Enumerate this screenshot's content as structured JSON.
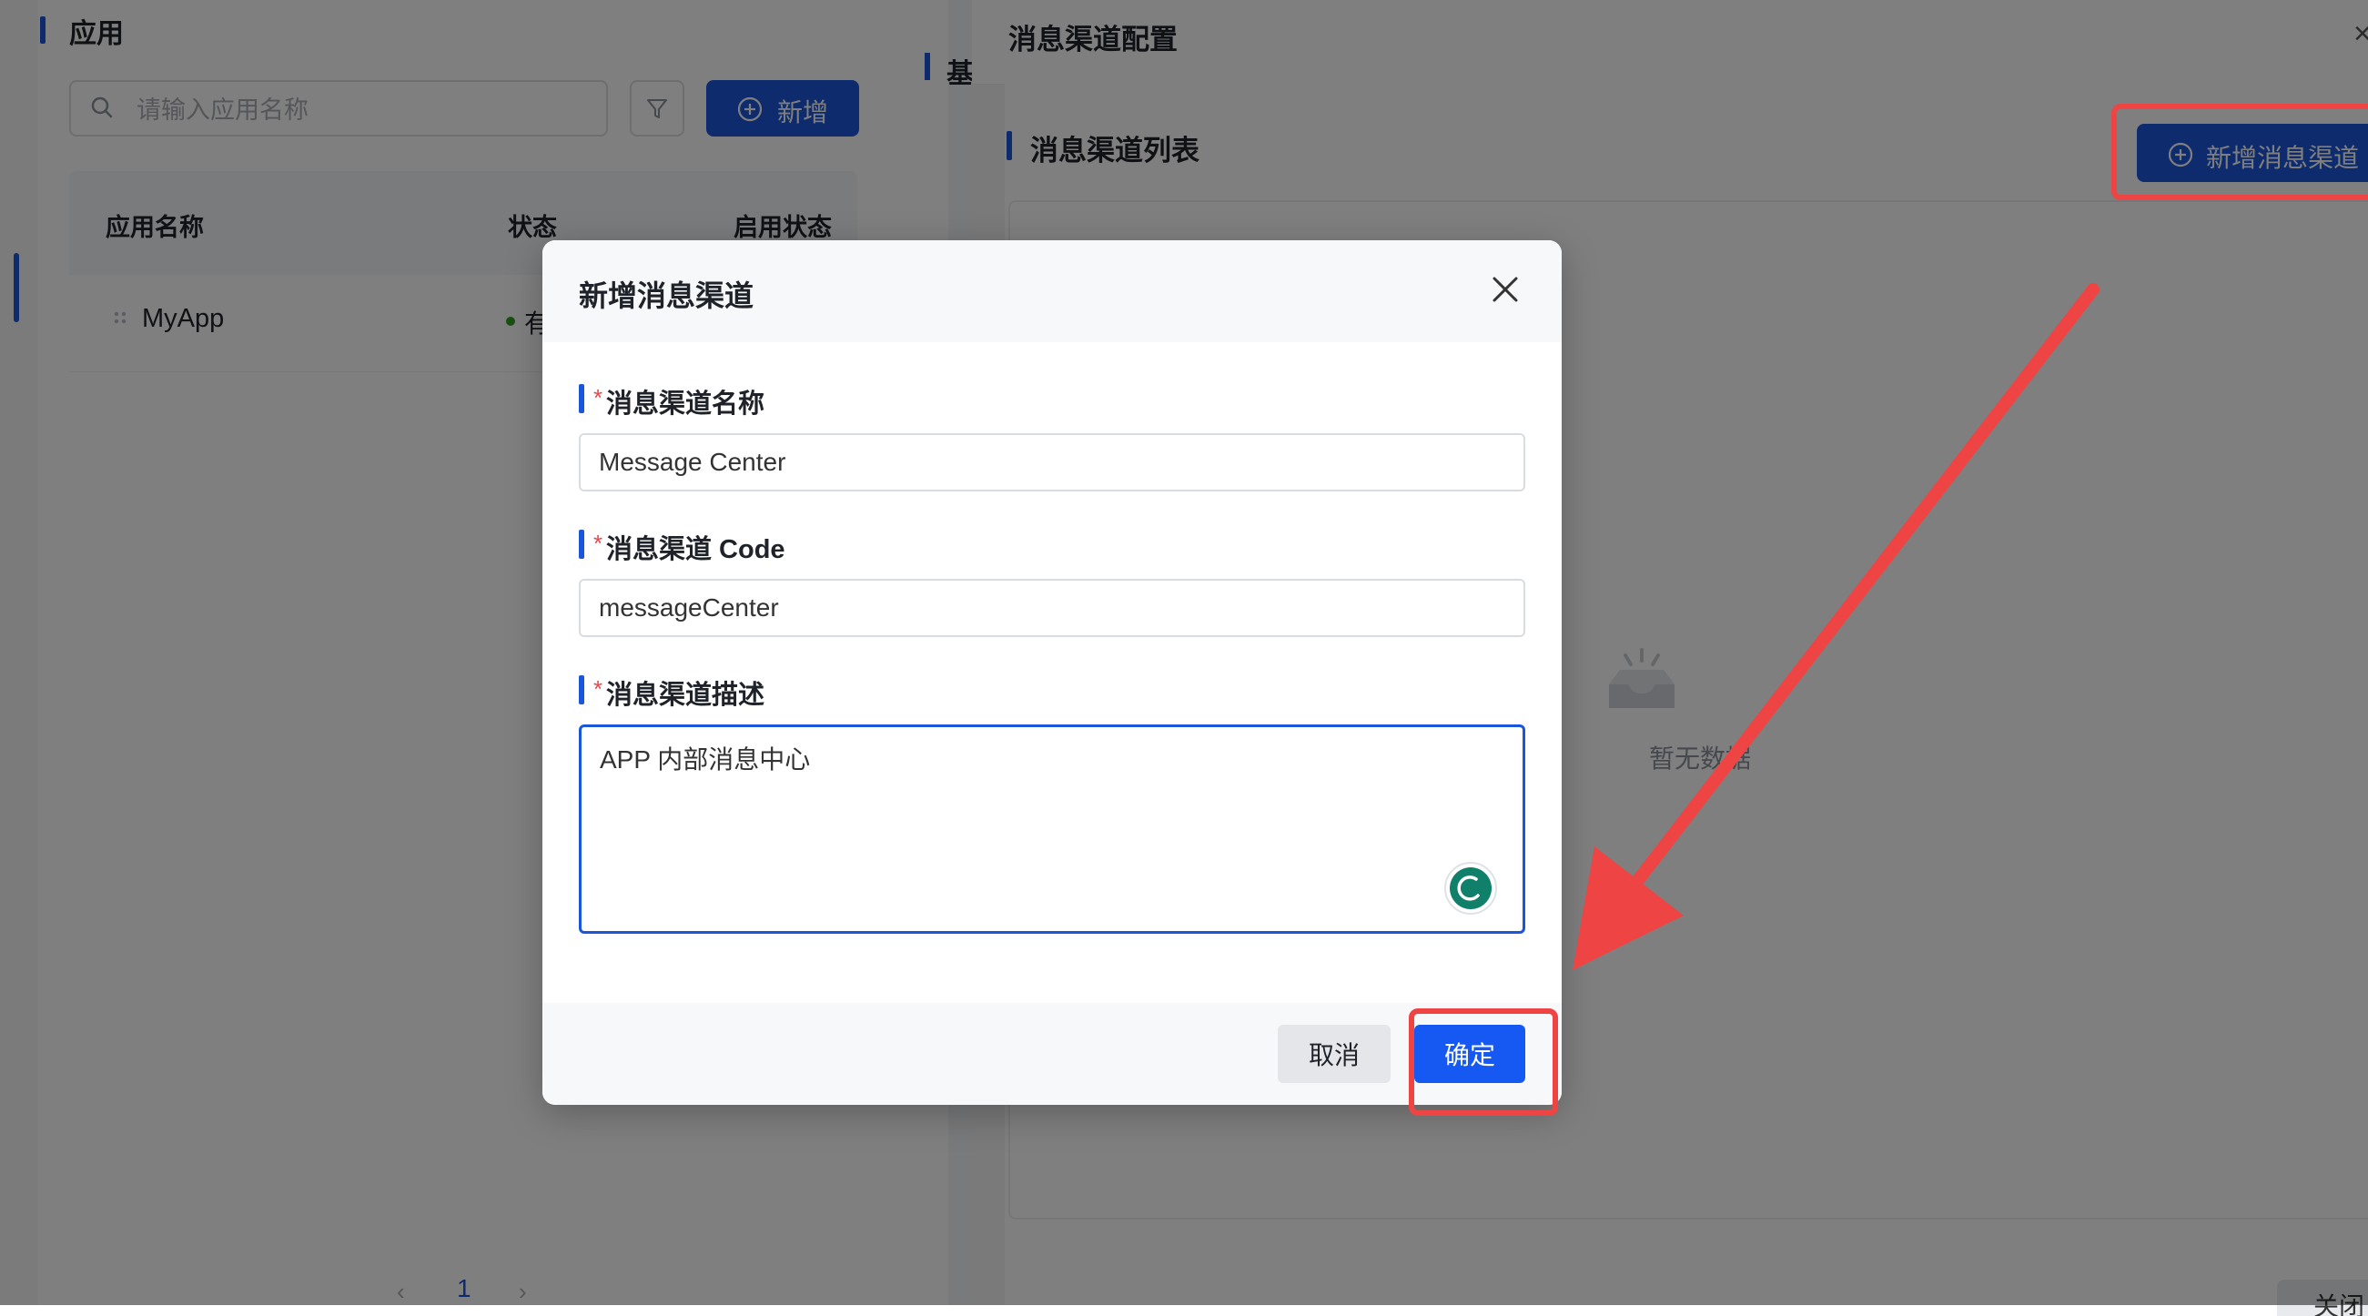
{
  "base": {
    "section_title": "应用",
    "search_placeholder": "请输入应用名称",
    "add_button": "新增",
    "table_headers": [
      "应用名称",
      "状态",
      "启用状态"
    ],
    "rows": [
      {
        "name": "MyApp",
        "status": "有效"
      }
    ],
    "section2_title": "基",
    "pager_current": "1",
    "pager_prev": "‹",
    "pager_next": "›"
  },
  "drawer": {
    "title": "消息渠道配置",
    "close_glyph": "×",
    "list_title": "消息渠道列表",
    "add_channel_button": "新增消息渠道",
    "empty_text": "暂无数据",
    "footer_button": "关闭"
  },
  "modal": {
    "title": "新增消息渠道",
    "required_mark": "*",
    "fields": [
      {
        "label": "消息渠道名称",
        "value": "Message Center"
      },
      {
        "label": "消息渠道 Code",
        "value": "messageCenter"
      },
      {
        "label": "消息渠道描述",
        "value": "APP 内部消息中心"
      }
    ],
    "cancel_button": "取消",
    "ok_button": "确定"
  },
  "colors": {
    "primary": "#1a56db",
    "confirm": "#1658f2",
    "annotation": "#ef4444",
    "required": "#e5484d",
    "status_ok": "#2ea121"
  },
  "icons": [
    "search-icon",
    "filter-icon",
    "plus-circle-icon",
    "drag-handle-icon",
    "close-icon",
    "empty-inbox-icon",
    "assistant-icon"
  ]
}
